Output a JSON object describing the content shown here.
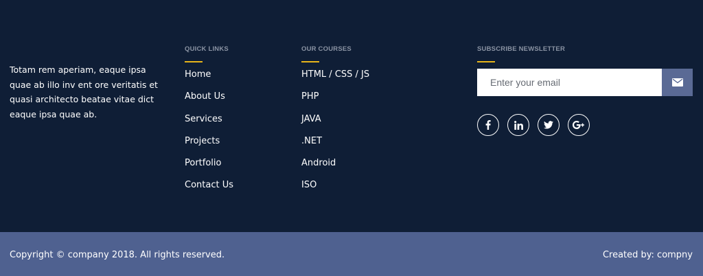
{
  "about": {
    "text": "Totam rem aperiam, eaque ipsa quae ab illo inv ent ore veritatis et quasi architecto beatae vitae dict eaque ipsa quae ab."
  },
  "quick_links": {
    "heading": "QUICK LINKS",
    "items": [
      "Home",
      "About Us",
      "Services",
      "Projects",
      "Portfolio",
      "Contact Us"
    ]
  },
  "courses": {
    "heading": "OUR COURSES",
    "items": [
      "HTML / CSS / JS",
      "PHP",
      "JAVA",
      ".NET",
      "Android",
      "ISO"
    ]
  },
  "newsletter": {
    "heading": "SUBSCRIBE NEWSLETTER",
    "email_placeholder": "Enter your email",
    "submit_icon": "envelope-icon"
  },
  "social": [
    {
      "name": "facebook-icon",
      "glyph": "f"
    },
    {
      "name": "linkedin-icon",
      "glyph": "in"
    },
    {
      "name": "twitter-icon",
      "glyph": "t"
    },
    {
      "name": "google-plus-icon",
      "glyph": "G+"
    }
  ],
  "bottom": {
    "copyright": "Copyright © company 2018. All rights reserved.",
    "credit": "Created by: compny"
  },
  "colors": {
    "footer_bg": "#0f1e36",
    "bottom_bg": "#4f6190",
    "accent": "#e8b51a",
    "button_bg": "#5a6a95"
  }
}
